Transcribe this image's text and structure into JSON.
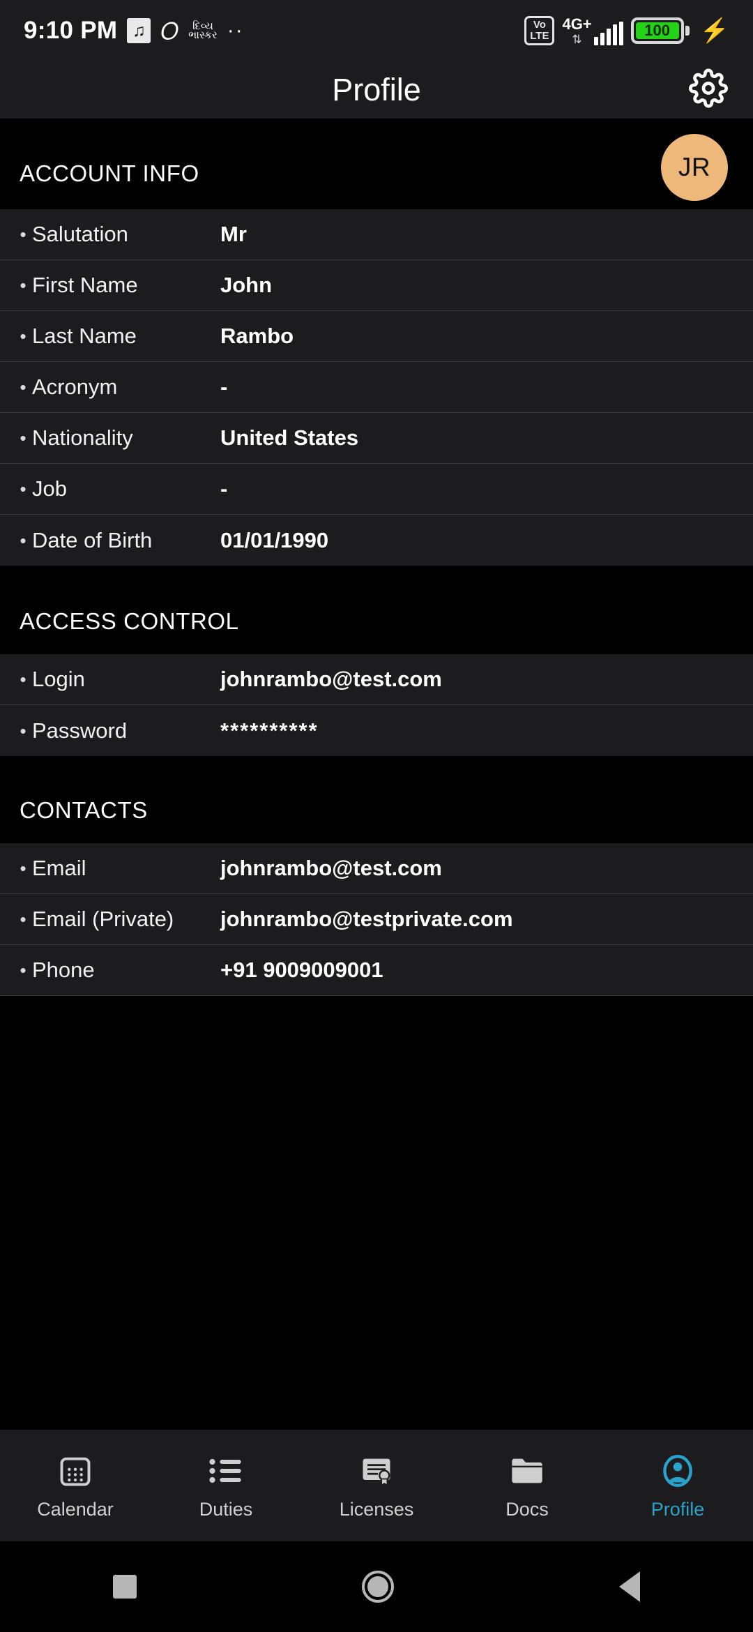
{
  "statusbar": {
    "time": "9:10 PM",
    "icons_left": [
      "music-note-icon",
      "m-app-icon",
      "gujarati-app-icon",
      "more-notifications-icon"
    ],
    "gujarati_line1": "દિવ્ય",
    "gujarati_line2": "ભાસ્કર",
    "more_dots": "··",
    "volte_top": "Vo",
    "volte_bottom": "LTE",
    "network": "4G+",
    "data_arrows": "⇅",
    "battery_level": "100",
    "charging_glyph": "⚡"
  },
  "appbar": {
    "title": "Profile",
    "settings_icon": "gear-icon"
  },
  "avatar": {
    "initials": "JR",
    "color": "#edb87a"
  },
  "theme": {
    "accent": "#29a3cc",
    "row_bg": "#1c1c1e",
    "section_bg": "#000000",
    "divider": "#3a3a3c"
  },
  "sections": [
    {
      "title": "ACCOUNT INFO",
      "rows": [
        {
          "label": "Salutation",
          "value": "Mr"
        },
        {
          "label": "First Name",
          "value": "John"
        },
        {
          "label": "Last Name",
          "value": "Rambo"
        },
        {
          "label": "Acronym",
          "value": "-"
        },
        {
          "label": "Nationality",
          "value": "United States"
        },
        {
          "label": "Job",
          "value": "-"
        },
        {
          "label": "Date of Birth",
          "value": "01/01/1990"
        }
      ]
    },
    {
      "title": "ACCESS CONTROL",
      "rows": [
        {
          "label": "Login",
          "value": "johnrambo@test.com"
        },
        {
          "label": "Password",
          "value": "**********"
        }
      ]
    },
    {
      "title": "CONTACTS",
      "rows": [
        {
          "label": "Email",
          "value": "johnrambo@test.com"
        },
        {
          "label": "Email (Private)",
          "value": "johnrambo@testprivate.com"
        },
        {
          "label": "Phone",
          "value": "+91 9009009001"
        }
      ]
    }
  ],
  "bullet": "•",
  "tabs": [
    {
      "label": "Calendar",
      "icon": "calendar-icon",
      "active": false
    },
    {
      "label": "Duties",
      "icon": "list-icon",
      "active": false
    },
    {
      "label": "Licenses",
      "icon": "certificate-icon",
      "active": false
    },
    {
      "label": "Docs",
      "icon": "folder-icon",
      "active": false
    },
    {
      "label": "Profile",
      "icon": "person-circle-icon",
      "active": true
    }
  ],
  "navbar": {
    "recents": "square-icon",
    "home": "circle-icon",
    "back": "triangle-back-icon"
  }
}
